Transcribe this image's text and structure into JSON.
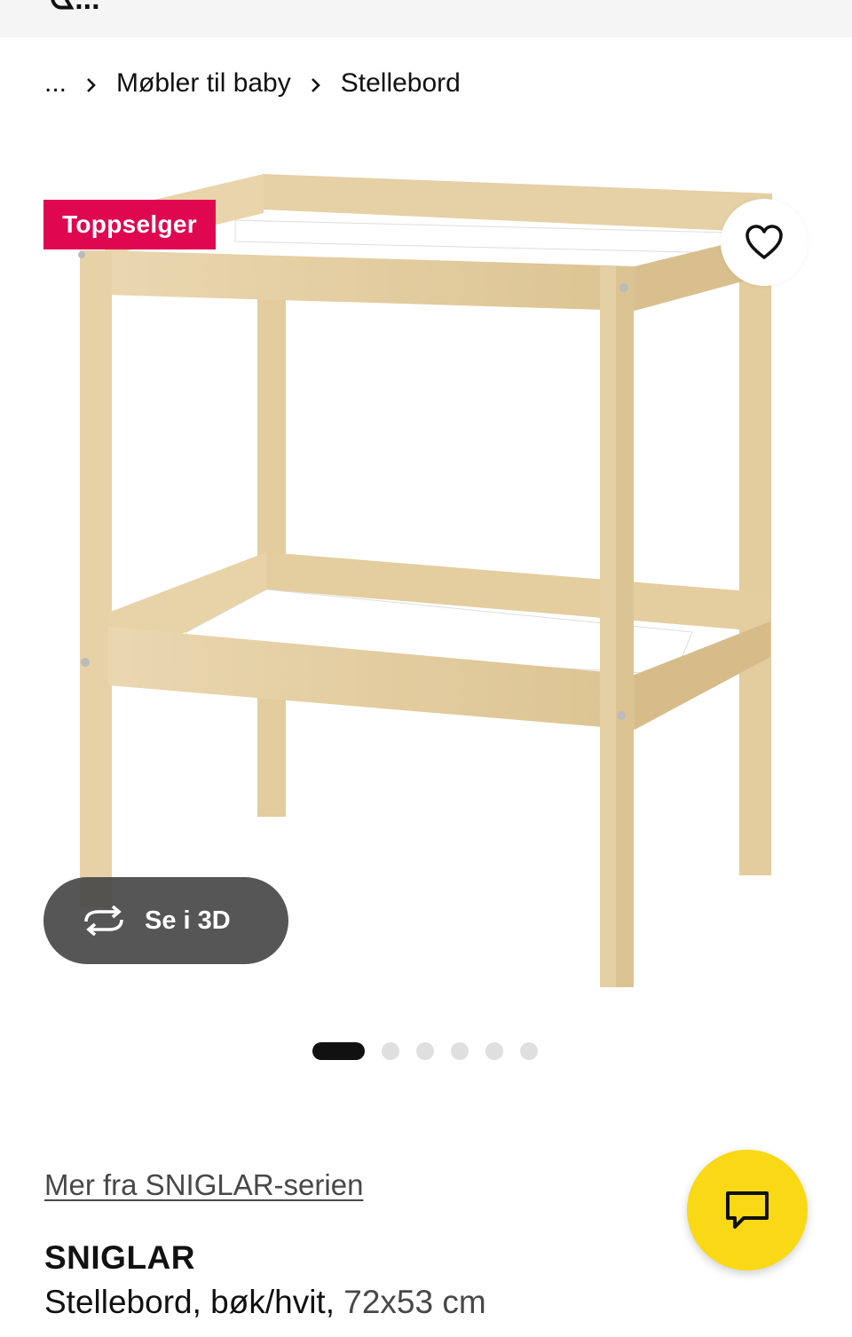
{
  "top_bar": {
    "glyph": "ᗧ..."
  },
  "breadcrumb": {
    "items": [
      {
        "label": "..."
      },
      {
        "label": "Møbler til baby"
      },
      {
        "label": "Stellebord"
      }
    ]
  },
  "product": {
    "badge": "Toppselger",
    "view_3d_label": "Se i 3D",
    "image_count": 6,
    "active_image_index": 0,
    "series_link": "Mer fra SNIGLAR-serien",
    "name": "SNIGLAR",
    "description": "Stellebord, bøk/hvit,",
    "size": "72x53 cm"
  },
  "icons": {
    "favorite": "heart-icon",
    "view_3d": "rotate-icon",
    "chat": "chat-bubble-icon",
    "breadcrumb_separator": "chevron-right-icon"
  },
  "colors": {
    "badge_bg": "#e00751",
    "chat_bg": "#f9d816",
    "view3d_bg": "#484848",
    "dot_active": "#111111",
    "dot_inactive": "#dfdfdf",
    "wood": "#e8d3a9"
  }
}
